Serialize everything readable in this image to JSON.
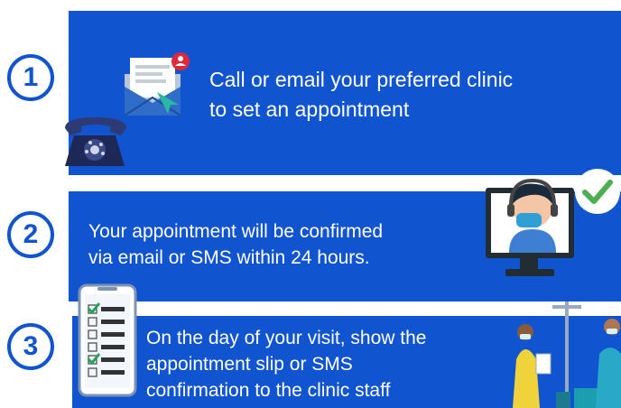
{
  "steps": [
    {
      "number": "1",
      "lines": [
        "Call or email your preferred clinic",
        "to set an appointment"
      ],
      "icons": [
        "envelope-icon",
        "telephone-icon"
      ]
    },
    {
      "number": "2",
      "lines": [
        "Your appointment will be confirmed",
        "via email or SMS within 24 hours."
      ],
      "icons": [
        "monitor-agent-icon",
        "checkmark-icon"
      ]
    },
    {
      "number": "3",
      "lines": [
        "On the day of your visit, show the",
        "appointment slip or SMS",
        "confirmation to the clinic staff"
      ],
      "icons": [
        "phone-checklist-icon",
        "clinic-staff-icon"
      ]
    }
  ],
  "colors": {
    "panel": "#1154d0",
    "number_text": "#1154d0",
    "text": "#ffffff",
    "check": "#4caf50"
  }
}
